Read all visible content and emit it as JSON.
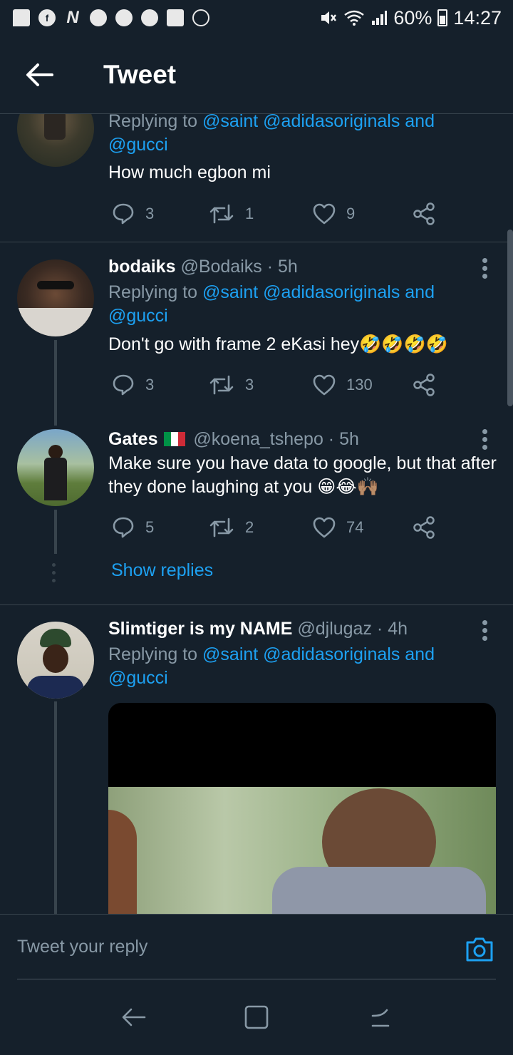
{
  "status_bar": {
    "battery": "60%",
    "time": "14:27",
    "icons": [
      "message-icon",
      "facebook-icon",
      "netflix-icon",
      "chrome-icon",
      "chrome-icon",
      "chrome-icon",
      "gallery-icon",
      "sync-icon",
      "mute-icon",
      "wifi-icon",
      "signal-icon",
      "battery-icon"
    ]
  },
  "header": {
    "title": "Tweet",
    "back_icon": "arrow-left-icon"
  },
  "tweets": [
    {
      "replying_prefix": "Replying to ",
      "mentions": [
        "@saint",
        "@adidasoriginals",
        "@gucci"
      ],
      "and": "and",
      "text": "How much egbon mi",
      "replies": "3",
      "retweets": "1",
      "likes": "9"
    },
    {
      "name": "bodaiks",
      "handle": "@Bodaiks",
      "time": "5h",
      "replying_prefix": "Replying to ",
      "mentions": [
        "@saint",
        "@adidasoriginals",
        "@gucci"
      ],
      "and": "and",
      "text": "Don't go with frame 2 eKasi hey",
      "emoji": "🤣🤣🤣🤣",
      "replies": "3",
      "retweets": "3",
      "likes": "130"
    },
    {
      "name": "Gates",
      "handle": "@koena_tshepo",
      "time": "5h",
      "flag_colors": [
        "#009246",
        "#ffffff",
        "#ce2b37"
      ],
      "text": "Make sure you have data to google, but that after they done laughing at you",
      "emoji": "😁😂🙌🏽",
      "replies": "5",
      "retweets": "2",
      "likes": "74",
      "show_replies": "Show replies"
    },
    {
      "name": "Slimtiger is my NAME",
      "handle": "@djlugaz",
      "time": "4h",
      "replying_prefix": "Replying to ",
      "mentions": [
        "@saint",
        "@adidasoriginals",
        "@gucci"
      ],
      "and": "and"
    }
  ],
  "reply_bar": {
    "placeholder": "Tweet your reply",
    "camera_icon": "camera-icon"
  },
  "nav_bar": {
    "icons": [
      "back-nav-icon",
      "recents-icon",
      "home-nav-icon"
    ]
  },
  "colors": {
    "background": "#15202b",
    "accent": "#1da1f2",
    "muted": "#8899a6",
    "divider": "#38444d"
  }
}
